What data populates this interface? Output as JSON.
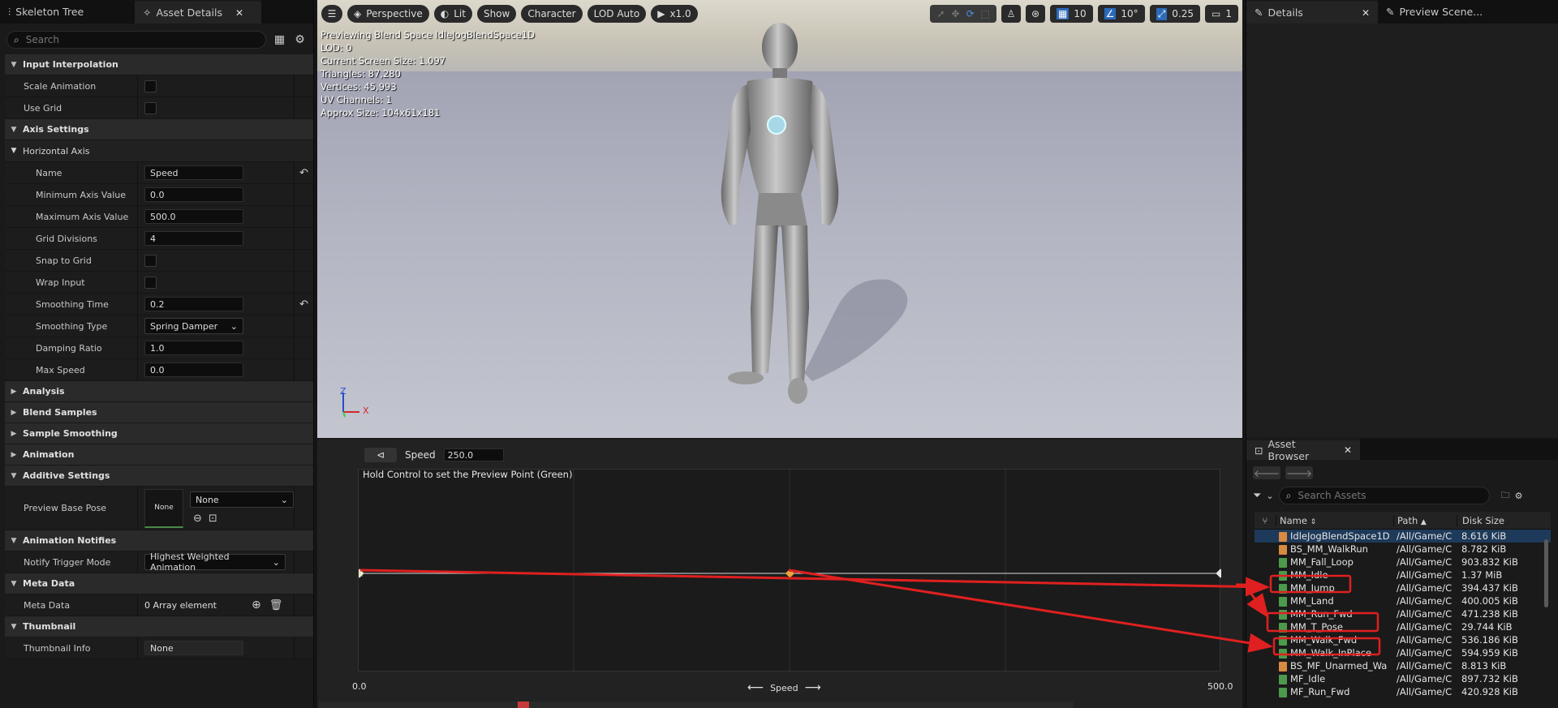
{
  "left_panel": {
    "tabs": [
      {
        "label": "Skeleton Tree",
        "close": ""
      },
      {
        "label": "Asset Details",
        "close": "✕"
      }
    ],
    "search": {
      "placeholder": "Search"
    },
    "sections": {
      "input_interpolation": "Input Interpolation",
      "axis_settings": "Axis Settings",
      "horizontal_axis": "Horizontal Axis",
      "analysis": "Analysis",
      "blend_samples": "Blend Samples",
      "sample_smoothing": "Sample Smoothing",
      "animation": "Animation",
      "additive_settings": "Additive Settings",
      "animation_notifies": "Animation Notifies",
      "meta_data": "Meta Data",
      "thumbnail": "Thumbnail"
    },
    "props": {
      "scale_animation": {
        "label": "Scale Animation",
        "checked": false
      },
      "use_grid": {
        "label": "Use Grid",
        "checked": false
      },
      "name": {
        "label": "Name",
        "value": "Speed"
      },
      "min_axis": {
        "label": "Minimum Axis Value",
        "value": "0.0"
      },
      "max_axis": {
        "label": "Maximum Axis Value",
        "value": "500.0"
      },
      "grid_divisions": {
        "label": "Grid Divisions",
        "value": "4"
      },
      "snap_to_grid": {
        "label": "Snap to Grid",
        "checked": false
      },
      "wrap_input": {
        "label": "Wrap Input",
        "checked": false
      },
      "smoothing_time": {
        "label": "Smoothing Time",
        "value": "0.2"
      },
      "smoothing_type": {
        "label": "Smoothing Type",
        "value": "Spring Damper"
      },
      "damping_ratio": {
        "label": "Damping Ratio",
        "value": "1.0"
      },
      "max_speed": {
        "label": "Max Speed",
        "value": "0.0"
      },
      "preview_base_pose": {
        "label": "Preview Base Pose",
        "thumb": "None",
        "value": "None"
      },
      "notify_trigger_mode": {
        "label": "Notify Trigger Mode",
        "value": "Highest Weighted Animation"
      },
      "meta_data": {
        "label": "Meta Data",
        "value": "0 Array element"
      },
      "thumbnail_info": {
        "label": "Thumbnail Info",
        "value": "None"
      }
    }
  },
  "viewport": {
    "toolbar": {
      "perspective": "Perspective",
      "lit": "Lit",
      "show": "Show",
      "character": "Character",
      "lod": "LOD Auto",
      "play_rate": "x1.0",
      "grid_snap": "10",
      "rot_snap": "10°",
      "scale_snap": "0.25",
      "camera_speed": "1"
    },
    "info": [
      "Previewing Blend Space IdleJogBlendSpace1D",
      "LOD: 0",
      "Current Screen Size: 1.097",
      "Triangles: 87,280",
      "Vertices: 45,993",
      "UV Channels: 1",
      "Approx Size: 104x61x181"
    ],
    "axis_labels": {
      "z": "Z",
      "x": "X"
    }
  },
  "blend_editor": {
    "param_label": "Speed",
    "param_value": "250.0",
    "hint": "Hold Control to set the Preview Point (Green)",
    "axis_min": "0.0",
    "axis_max": "500.0",
    "axis_name": "Speed",
    "samples": [
      0.0,
      250.0,
      500.0
    ],
    "preview_value": 0.0
  },
  "right_panel": {
    "tabs": [
      {
        "label": "Details",
        "close": "✕"
      },
      {
        "label": "Preview Scene...",
        "close": ""
      }
    ],
    "asset_browser": {
      "tab_label": "Asset Browser",
      "tab_close": "✕",
      "search_placeholder": "Search Assets",
      "columns": {
        "name": "Name",
        "path": "Path",
        "size": "Disk Size"
      },
      "rows": [
        {
          "name": "IdleJogBlendSpace1D",
          "path": "/All/Game/C",
          "size": "8.616 KiB",
          "kind": "blendspace",
          "selected": true
        },
        {
          "name": "BS_MM_WalkRun",
          "path": "/All/Game/C",
          "size": "8.782 KiB",
          "kind": "blendspace",
          "selected": false
        },
        {
          "name": "MM_Fall_Loop",
          "path": "/All/Game/C",
          "size": "903.832 KiB",
          "kind": "anim",
          "selected": false
        },
        {
          "name": "MM_Idle",
          "path": "/All/Game/C",
          "size": "1.37 MiB",
          "kind": "anim",
          "selected": false
        },
        {
          "name": "MM_Jump",
          "path": "/All/Game/C",
          "size": "394.437 KiB",
          "kind": "anim",
          "selected": false
        },
        {
          "name": "MM_Land",
          "path": "/All/Game/C",
          "size": "400.005 KiB",
          "kind": "anim",
          "selected": false
        },
        {
          "name": "MM_Run_Fwd",
          "path": "/All/Game/C",
          "size": "471.238 KiB",
          "kind": "anim",
          "selected": false
        },
        {
          "name": "MM_T_Pose",
          "path": "/All/Game/C",
          "size": "29.744 KiB",
          "kind": "anim",
          "selected": false
        },
        {
          "name": "MM_Walk_Fwd",
          "path": "/All/Game/C",
          "size": "536.186 KiB",
          "kind": "anim",
          "selected": false
        },
        {
          "name": "MM_Walk_InPlace",
          "path": "/All/Game/C",
          "size": "594.959 KiB",
          "kind": "anim",
          "selected": false
        },
        {
          "name": "BS_MF_Unarmed_Wa",
          "path": "/All/Game/C",
          "size": "8.813 KiB",
          "kind": "blendspace",
          "selected": false
        },
        {
          "name": "MF_Idle",
          "path": "/All/Game/C",
          "size": "897.732 KiB",
          "kind": "anim",
          "selected": false
        },
        {
          "name": "MF_Run_Fwd",
          "path": "/All/Game/C",
          "size": "420.928 KiB",
          "kind": "anim",
          "selected": false
        }
      ]
    }
  },
  "colors": {
    "accent": "#2a6ab8",
    "annotation": "#e02020",
    "sample_point": "#e8a33a"
  }
}
